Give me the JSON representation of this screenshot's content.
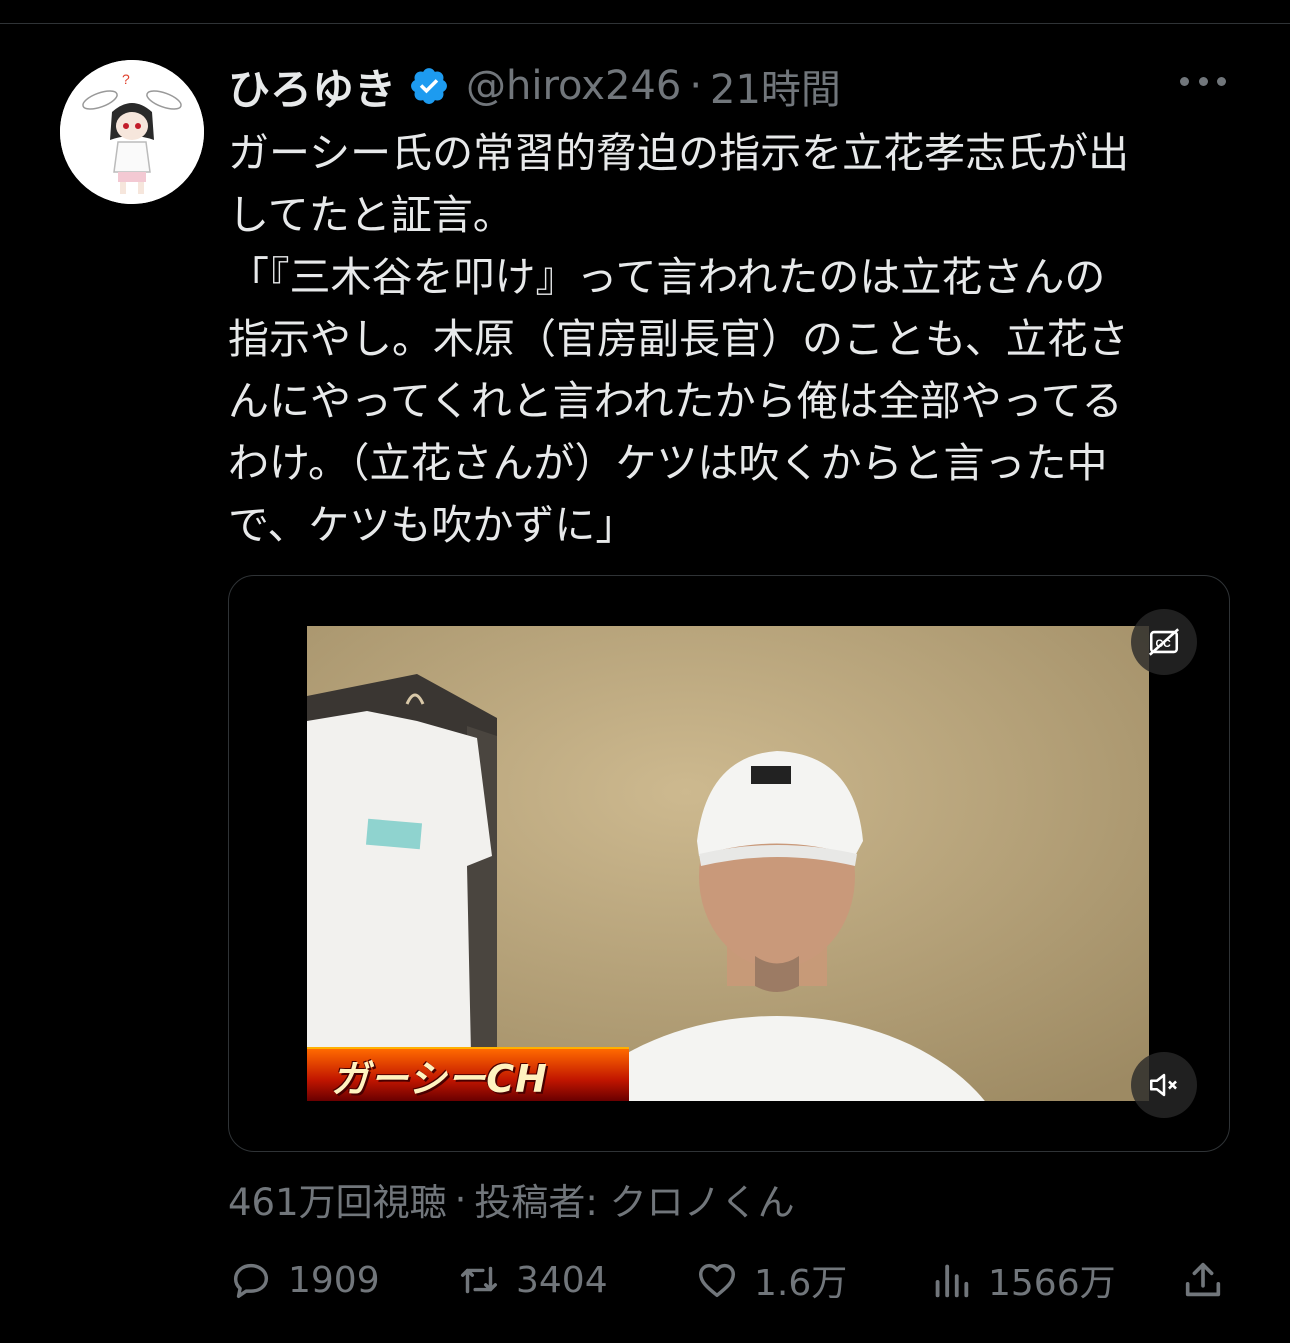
{
  "user": {
    "display_name": "ひろゆき",
    "handle": "@hirox246",
    "separator": "·",
    "time": "21時間",
    "verified": true
  },
  "tweet": {
    "lines": [
      "ガーシー氏の常習的脅迫の指示を立花孝志氏が出",
      "してたと証言。",
      "「『三木谷を叩け』って言われたのは立花さんの",
      "指示やし。木原（官房副長官）のことも、立花さ",
      "んにやってくれと言われたから俺は全部やってる",
      "わけ。（立花さんが）ケツは吹くからと言った中",
      "で、ケツも吹かずに」"
    ]
  },
  "media": {
    "channel_label": "ガーシーCH",
    "cc_icon": "cc-off-icon",
    "mute_icon": "muted-speaker-icon"
  },
  "meta": {
    "views": "461万回視聴",
    "separator": "·",
    "poster": "投稿者: クロノくん"
  },
  "actions": {
    "reply_count": "1909",
    "retweet_count": "3404",
    "like_count": "1.6万",
    "view_count": "1566万"
  },
  "colors": {
    "background": "#000000",
    "text": "#e7e9ea",
    "muted": "#71767b",
    "verified": "#1d9bf0",
    "divider": "#2f3336"
  }
}
